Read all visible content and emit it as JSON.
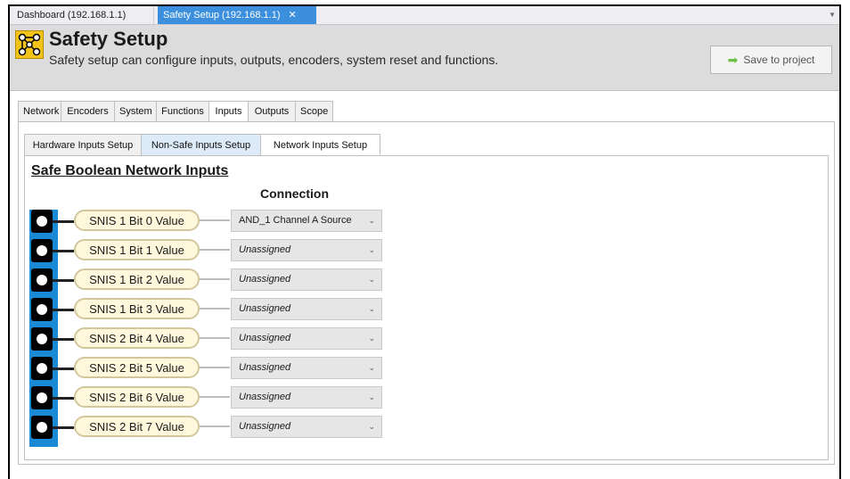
{
  "doc_tabs": [
    {
      "label": "Dashboard (192.168.1.1)"
    },
    {
      "label": "Safety Setup (192.168.1.1)",
      "close": "✕"
    }
  ],
  "header": {
    "title": "Safety Setup",
    "subtitle": "Safety setup can configure inputs, outputs, encoders, system reset and functions.",
    "save_label": "Save to project",
    "logo_icon": "network-nodes-icon",
    "logo_color": "#f3c317"
  },
  "main_tabs": [
    {
      "label": "Network"
    },
    {
      "label": "Encoders"
    },
    {
      "label": "System"
    },
    {
      "label": "Functions"
    },
    {
      "label": "Inputs"
    },
    {
      "label": "Outputs"
    },
    {
      "label": "Scope"
    }
  ],
  "selected_main_tab": "Inputs",
  "sub_tabs": [
    {
      "label": "Hardware Inputs Setup"
    },
    {
      "label": "Non-Safe Inputs Setup"
    },
    {
      "label": "Network Inputs Setup"
    }
  ],
  "selected_sub_tab": "Network Inputs Setup",
  "section": {
    "title": "Safe Boolean Network Inputs",
    "connection_header": "Connection"
  },
  "inputs": [
    {
      "label": "SNIS 1 Bit 0 Value",
      "connection": "AND_1 Channel A Source"
    },
    {
      "label": "SNIS 1 Bit 1 Value",
      "connection": "Unassigned"
    },
    {
      "label": "SNIS 1 Bit 2 Value",
      "connection": "Unassigned"
    },
    {
      "label": "SNIS 1 Bit 3 Value",
      "connection": "Unassigned"
    },
    {
      "label": "SNIS 2 Bit 4 Value",
      "connection": "Unassigned"
    },
    {
      "label": "SNIS 2 Bit 5 Value",
      "connection": "Unassigned"
    },
    {
      "label": "SNIS 2 Bit 6 Value",
      "connection": "Unassigned"
    },
    {
      "label": "SNIS 2 Bit 7 Value",
      "connection": "Unassigned"
    }
  ],
  "colors": {
    "active_tab": "#3c8fdc",
    "bus_bar": "#1a8ad4",
    "pill_fill": "#fff8dc",
    "save_arrow": "#6cc04a"
  }
}
